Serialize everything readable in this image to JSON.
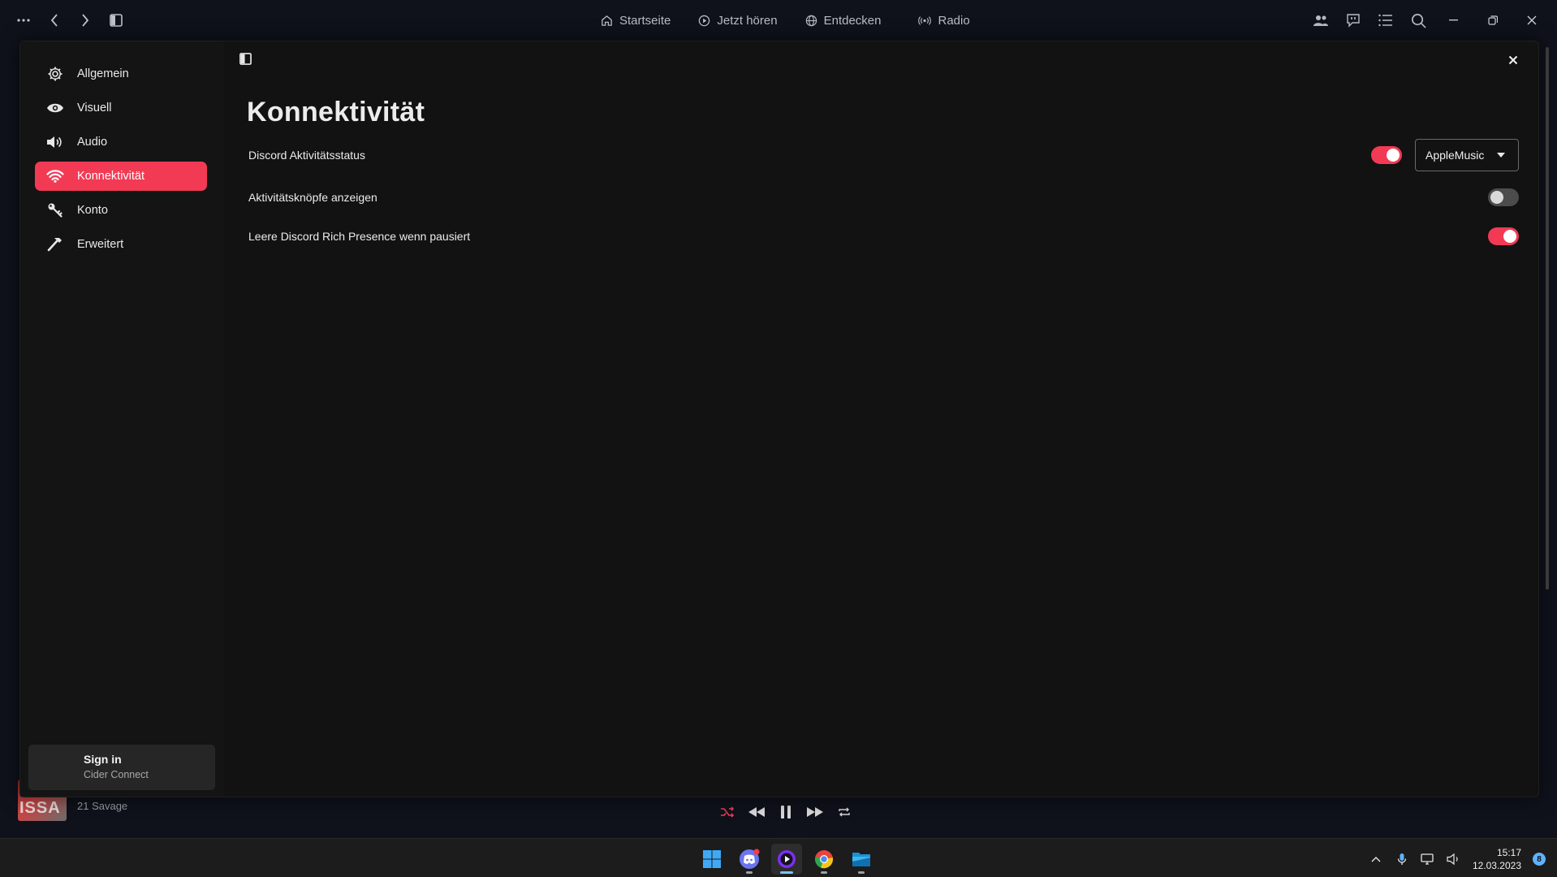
{
  "titlebar": {
    "nav": [
      {
        "label": "Startseite",
        "icon": "home-icon"
      },
      {
        "label": "Jetzt hören",
        "icon": "play-circle-icon"
      },
      {
        "label": "Entdecken",
        "icon": "globe-icon"
      },
      {
        "label": "Radio",
        "icon": "radio-icon"
      }
    ]
  },
  "settings": {
    "title": "Konnektivität",
    "sidebar": {
      "items": [
        {
          "label": "Allgemein",
          "icon": "gear-icon"
        },
        {
          "label": "Visuell",
          "icon": "eye-icon"
        },
        {
          "label": "Audio",
          "icon": "speaker-icon"
        },
        {
          "label": "Konnektivität",
          "icon": "wifi-icon",
          "active": true
        },
        {
          "label": "Konto",
          "icon": "key-icon"
        },
        {
          "label": "Erweitert",
          "icon": "hammer-icon"
        }
      ],
      "signin": {
        "title": "Sign in",
        "subtitle": "Cider Connect"
      }
    },
    "rows": [
      {
        "label": "Discord Aktivitätsstatus",
        "toggle": true,
        "select": "AppleMusic"
      },
      {
        "label": "Aktivitätsknöpfe anzeigen",
        "toggle": false
      },
      {
        "label": "Leere Discord Rich Presence wenn pausiert",
        "toggle": true
      }
    ]
  },
  "player": {
    "album_text": "ISSA",
    "artist": "21 Savage"
  },
  "taskbar": {
    "time": "15:17",
    "date": "12.03.2023",
    "notifications": "8"
  },
  "colors": {
    "accent": "#f23a55",
    "background": "#121212",
    "sidebar": "#141414"
  }
}
